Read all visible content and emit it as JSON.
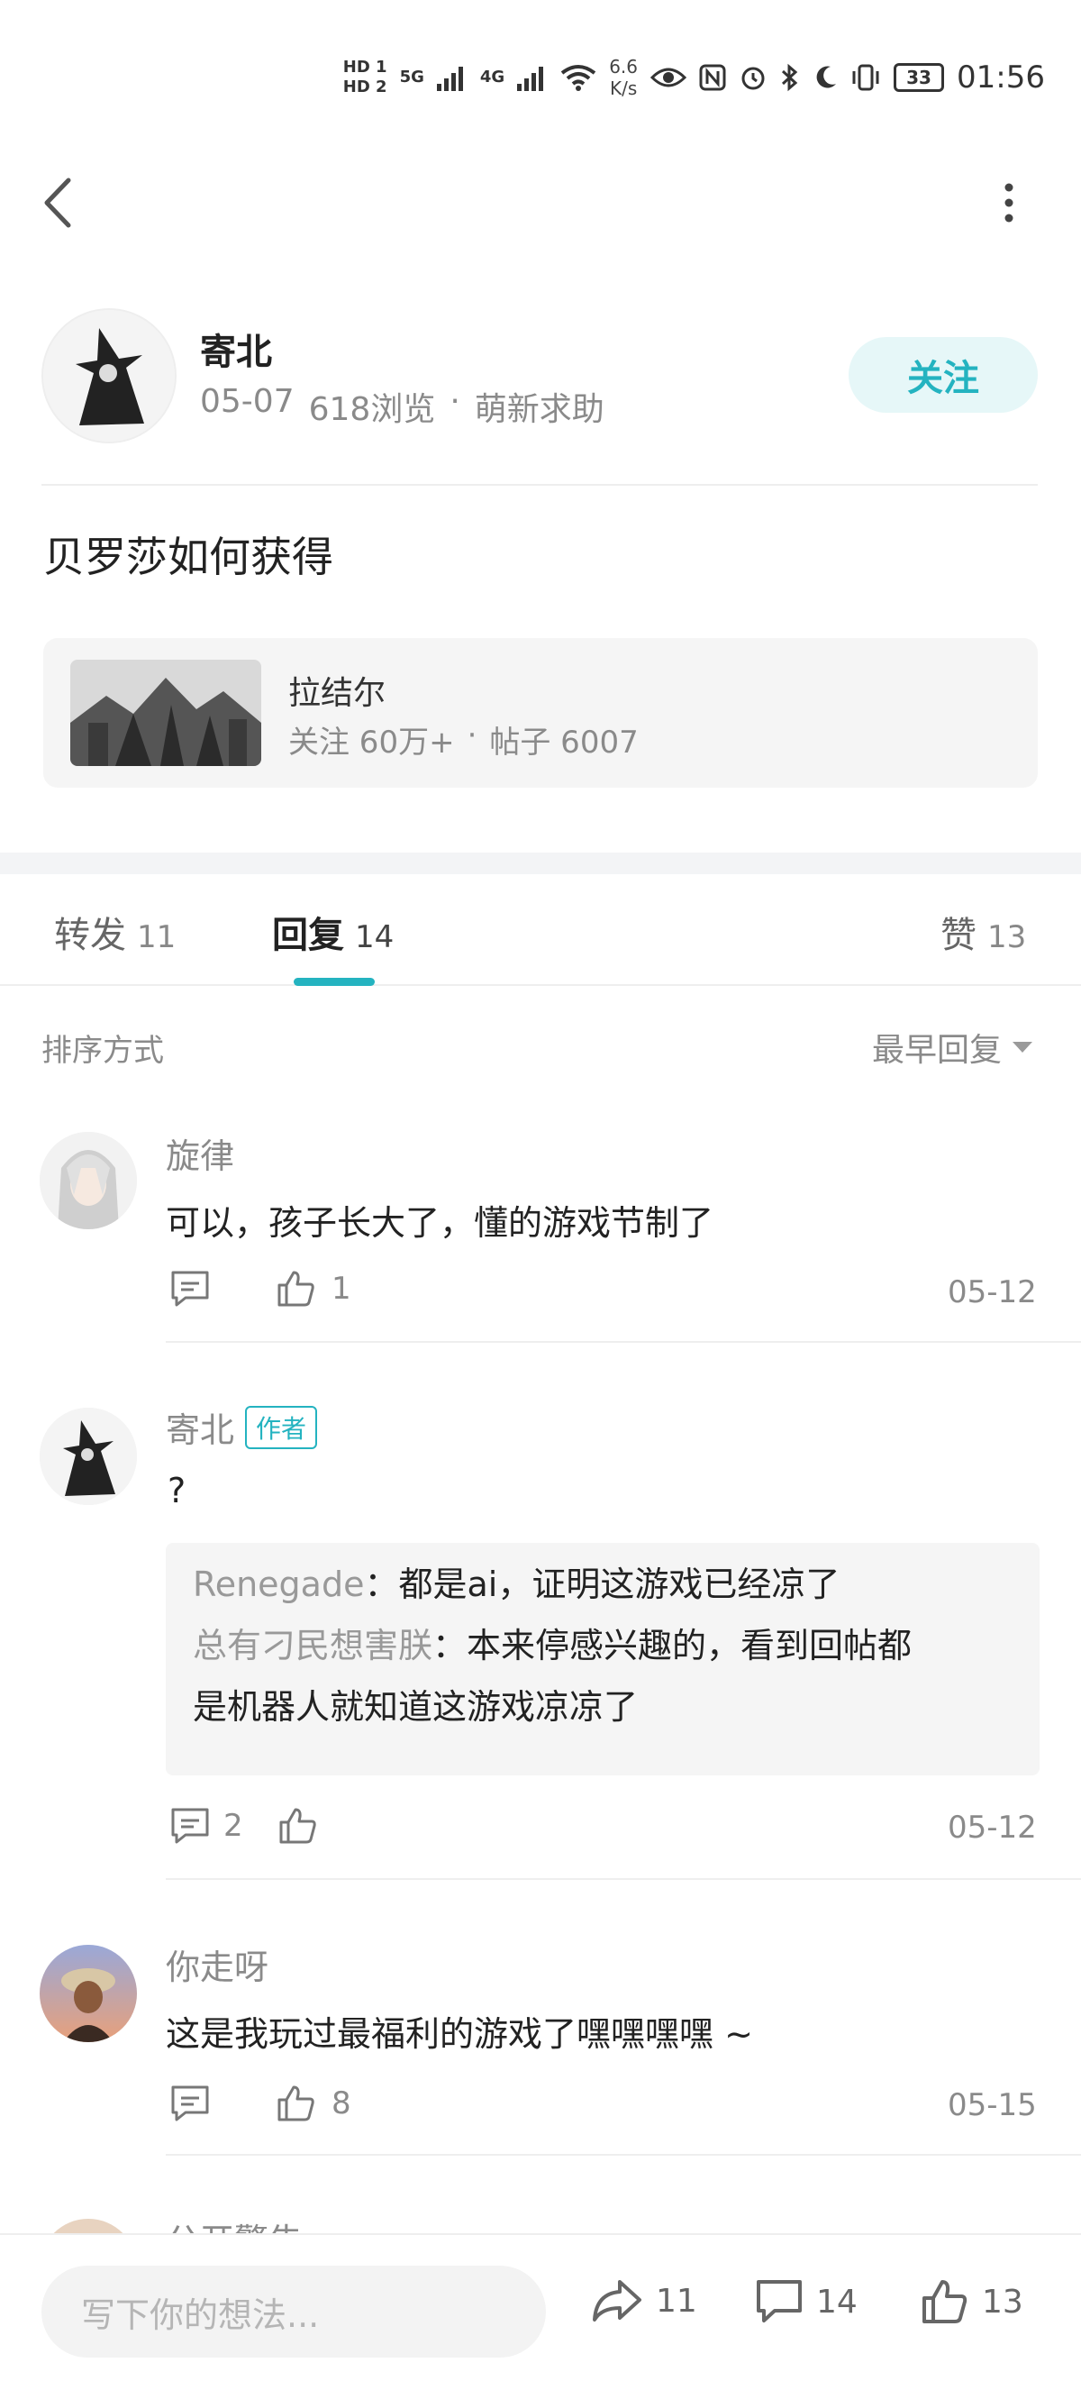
{
  "status_bar": {
    "sim1": "HD 1",
    "sim2": "HD 2",
    "net1": "5G",
    "net2": "4G",
    "speed_value": "6.6",
    "speed_unit": "K/s",
    "battery": "33",
    "time": "01:56"
  },
  "post": {
    "author": {
      "name": "寄北",
      "date": "05-07",
      "views": "618浏览",
      "separator": "·",
      "category": "萌新求助"
    },
    "follow_label": "关注",
    "title": "贝罗莎如何获得",
    "forum": {
      "name": "拉结尔",
      "followers": "关注 60万+",
      "separator": "·",
      "posts": "帖子 6007"
    }
  },
  "tabs": [
    {
      "label": "转发",
      "count": "11"
    },
    {
      "label": "回复",
      "count": "14"
    },
    {
      "label": "赞",
      "count": "13"
    }
  ],
  "sort": {
    "label": "排序方式",
    "value": "最早回复"
  },
  "comments": [
    {
      "user": "旋律",
      "text": "可以，孩子长大了，懂的游戏节制了",
      "reply_count": "",
      "like_count": "1",
      "date": "05-12"
    },
    {
      "user": "寄北",
      "badge": "作者",
      "text": "?",
      "quotes": [
        {
          "user": "Renegade",
          "sep": "：",
          "text": "都是ai，证明这游戏已经凉了"
        },
        {
          "user": "总有刁民想害朕",
          "sep": "：",
          "text": "本来停感兴趣的，看到回帖都",
          "text2": "是机器人就知道这游戏凉凉了"
        }
      ],
      "reply_count": "2",
      "like_count": "",
      "date": "05-12"
    },
    {
      "user": "你走呀",
      "text": "这是我玩过最福利的游戏了嘿嘿嘿嘿 ~",
      "reply_count": "",
      "like_count": "8",
      "date": "05-15"
    },
    {
      "user": "公开警告"
    }
  ],
  "bottom_bar": {
    "placeholder": "写下你的想法...",
    "share_count": "11",
    "comment_count": "14",
    "like_count": "13"
  },
  "colors": {
    "accent": "#24b3c0",
    "follow_bg": "#e6f7f8",
    "muted_text": "#8a8a8a"
  }
}
